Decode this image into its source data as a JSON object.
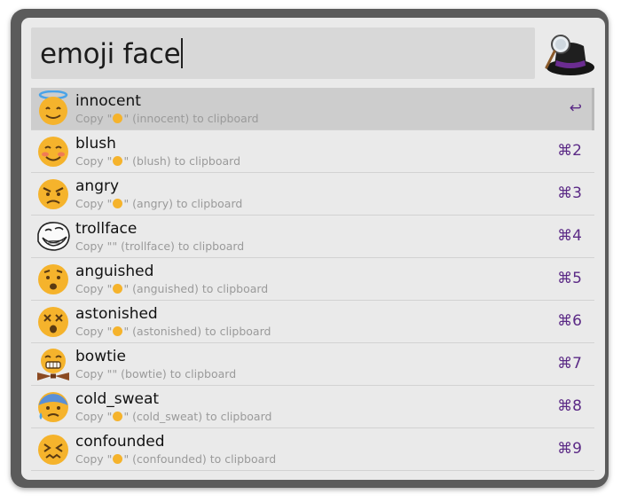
{
  "search": {
    "query": "emoji face"
  },
  "results": [
    {
      "title": "innocent",
      "pre": "Copy \"",
      "post": "\" (innocent) to clipboard",
      "has_emoji": true,
      "shortcut": "↩",
      "icon": "innocent-face-icon"
    },
    {
      "title": "blush",
      "pre": "Copy \"",
      "post": "\" (blush) to clipboard",
      "has_emoji": true,
      "shortcut": "⌘2",
      "icon": "blush-face-icon"
    },
    {
      "title": "angry",
      "pre": "Copy \"",
      "post": "\" (angry) to clipboard",
      "has_emoji": true,
      "shortcut": "⌘3",
      "icon": "angry-face-icon"
    },
    {
      "title": "trollface",
      "pre": "Copy \"",
      "post": "\" (trollface) to clipboard",
      "has_emoji": false,
      "shortcut": "⌘4",
      "icon": "trollface-icon"
    },
    {
      "title": "anguished",
      "pre": "Copy \"",
      "post": "\" (anguished) to clipboard",
      "has_emoji": true,
      "shortcut": "⌘5",
      "icon": "anguished-face-icon"
    },
    {
      "title": "astonished",
      "pre": "Copy \"",
      "post": "\" (astonished) to clipboard",
      "has_emoji": true,
      "shortcut": "⌘6",
      "icon": "astonished-face-icon"
    },
    {
      "title": "bowtie",
      "pre": "Copy \"",
      "post": "\" (bowtie) to clipboard",
      "has_emoji": false,
      "shortcut": "⌘7",
      "icon": "bowtie-face-icon"
    },
    {
      "title": "cold_sweat",
      "pre": "Copy \"",
      "post": "\" (cold_sweat) to clipboard",
      "has_emoji": true,
      "shortcut": "⌘8",
      "icon": "cold-sweat-face-icon"
    },
    {
      "title": "confounded",
      "pre": "Copy \"",
      "post": "\" (confounded) to clipboard",
      "has_emoji": true,
      "shortcut": "⌘9",
      "icon": "confounded-face-icon"
    }
  ],
  "colors": {
    "accent_shortcut": "#5b2a86",
    "emoji_yellow": "#f5b32c",
    "selected_row": "#cdcdcd"
  }
}
